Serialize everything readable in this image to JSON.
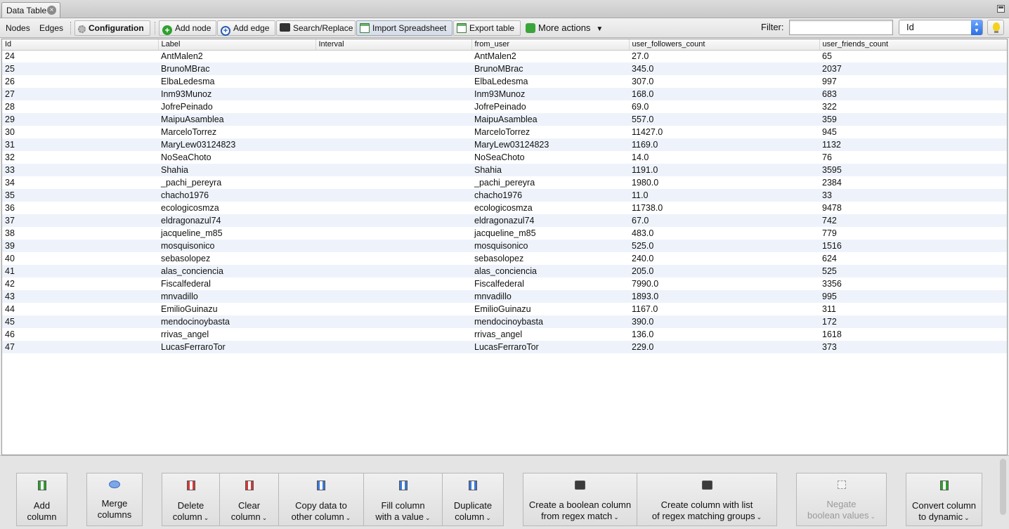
{
  "tab": {
    "title": "Data Table"
  },
  "toolbar": {
    "nodes": "Nodes",
    "edges": "Edges",
    "configuration": "Configuration",
    "add_node": "Add node",
    "add_edge": "Add edge",
    "search_replace": "Search/Replace",
    "import_spreadsheet": "Import Spreadsheet",
    "export_table": "Export table",
    "more_actions": "More actions",
    "filter_label": "Filter:",
    "filter_value": "",
    "column_select": "Id"
  },
  "table": {
    "columns": [
      "Id",
      "Label",
      "Interval",
      "from_user",
      "user_followers_count",
      "user_friends_count"
    ],
    "rows": [
      [
        "24",
        "AntMalen2",
        "",
        "AntMalen2",
        "27.0",
        "65"
      ],
      [
        "25",
        "BrunoMBrac",
        "",
        "BrunoMBrac",
        "345.0",
        "2037"
      ],
      [
        "26",
        "ElbaLedesma",
        "",
        "ElbaLedesma",
        "307.0",
        "997"
      ],
      [
        "27",
        "Inm93Munoz",
        "",
        "Inm93Munoz",
        "168.0",
        "683"
      ],
      [
        "28",
        "JofrePeinado",
        "",
        "JofrePeinado",
        "69.0",
        "322"
      ],
      [
        "29",
        "MaipuAsamblea",
        "",
        "MaipuAsamblea",
        "557.0",
        "359"
      ],
      [
        "30",
        "MarceloTorrez",
        "",
        "MarceloTorrez",
        "11427.0",
        "945"
      ],
      [
        "31",
        "MaryLew03124823",
        "",
        "MaryLew03124823",
        "1169.0",
        "1132"
      ],
      [
        "32",
        "NoSeaChoto",
        "",
        "NoSeaChoto",
        "14.0",
        "76"
      ],
      [
        "33",
        "Shahia",
        "",
        "Shahia",
        "1191.0",
        "3595"
      ],
      [
        "34",
        "_pachi_pereyra",
        "",
        "_pachi_pereyra",
        "1980.0",
        "2384"
      ],
      [
        "35",
        "chacho1976",
        "",
        "chacho1976",
        "11.0",
        "33"
      ],
      [
        "36",
        "ecologicosmza",
        "",
        "ecologicosmza",
        "11738.0",
        "9478"
      ],
      [
        "37",
        "eldragonazul74",
        "",
        "eldragonazul74",
        "67.0",
        "742"
      ],
      [
        "38",
        "jacqueline_m85",
        "",
        "jacqueline_m85",
        "483.0",
        "779"
      ],
      [
        "39",
        "mosquisonico",
        "",
        "mosquisonico",
        "525.0",
        "1516"
      ],
      [
        "40",
        "sebasolopez",
        "",
        "sebasolopez",
        "240.0",
        "624"
      ],
      [
        "41",
        "alas_conciencia",
        "",
        "alas_conciencia",
        "205.0",
        "525"
      ],
      [
        "42",
        "Fiscalfederal",
        "",
        "Fiscalfederal",
        "7990.0",
        "3356"
      ],
      [
        "43",
        "mnvadillo",
        "",
        "mnvadillo",
        "1893.0",
        "995"
      ],
      [
        "44",
        "EmilioGuinazu",
        "",
        "EmilioGuinazu",
        "1167.0",
        "311"
      ],
      [
        "45",
        "mendocinoybasta",
        "",
        "mendocinoybasta",
        "390.0",
        "172"
      ],
      [
        "46",
        "rrivas_angel",
        "",
        "rrivas_angel",
        "136.0",
        "1618"
      ],
      [
        "47",
        "LucasFerraroTor",
        "",
        "LucasFerraroTor",
        "229.0",
        "373"
      ]
    ]
  },
  "actions": {
    "add_column": [
      "Add",
      "column"
    ],
    "merge_columns": [
      "Merge",
      "columns"
    ],
    "delete_column": [
      "Delete",
      "column"
    ],
    "clear_column": [
      "Clear",
      "column"
    ],
    "copy_data": [
      "Copy data to",
      "other column"
    ],
    "fill_column": [
      "Fill column",
      "with a value"
    ],
    "duplicate_column": [
      "Duplicate",
      "column"
    ],
    "create_boolean": [
      "Create a boolean column",
      "from regex match"
    ],
    "create_list": [
      "Create column with list",
      "of regex matching groups"
    ],
    "negate_boolean": [
      "Negate",
      "boolean values"
    ],
    "convert_dynamic": [
      "Convert column",
      "to dynamic"
    ]
  }
}
